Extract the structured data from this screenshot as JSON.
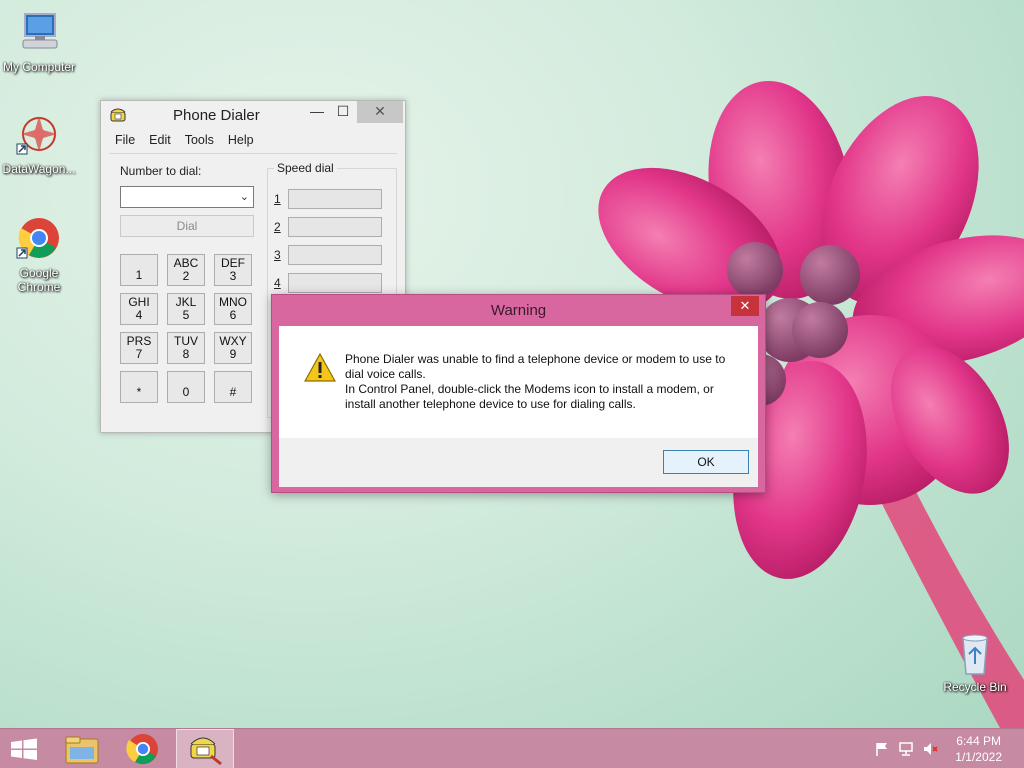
{
  "desktop": {
    "icons": [
      {
        "label": "My Computer",
        "icon": "computer-icon"
      },
      {
        "label": "DataWagon...",
        "icon": "datawagon-icon"
      },
      {
        "label": "Google Chrome",
        "icon": "chrome-icon"
      },
      {
        "label": "Recycle Bin",
        "icon": "recycle-bin-icon"
      }
    ]
  },
  "dialer": {
    "title": "Phone Dialer",
    "window_buttons": {
      "minimize": "—",
      "maximize": "☐",
      "close": "✕"
    },
    "menu": [
      "File",
      "Edit",
      "Tools",
      "Help"
    ],
    "number_label": "Number to dial:",
    "number_value": "",
    "dial_label": "Dial",
    "keypad": [
      {
        "letters": "",
        "digit": "1"
      },
      {
        "letters": "ABC",
        "digit": "2"
      },
      {
        "letters": "DEF",
        "digit": "3"
      },
      {
        "letters": "GHI",
        "digit": "4"
      },
      {
        "letters": "JKL",
        "digit": "5"
      },
      {
        "letters": "MNO",
        "digit": "6"
      },
      {
        "letters": "PRS",
        "digit": "7"
      },
      {
        "letters": "TUV",
        "digit": "8"
      },
      {
        "letters": "WXY",
        "digit": "9"
      },
      {
        "letters": "",
        "digit": "*"
      },
      {
        "letters": "",
        "digit": "0"
      },
      {
        "letters": "",
        "digit": "#"
      }
    ],
    "speed_dial_label": "Speed dial",
    "speed_dial": [
      "1",
      "2",
      "3",
      "4"
    ]
  },
  "warning": {
    "title": "Warning",
    "close": "✕",
    "message_line1": "Phone Dialer was unable to find a telephone device or modem to use to dial voice calls.",
    "message_line2": "In Control Panel, double-click the Modems icon to install a modem, or install another telephone device to use for dialing calls.",
    "ok_label": "OK"
  },
  "taskbar": {
    "items": [
      "start-icon",
      "file-explorer-icon",
      "chrome-icon",
      "phone-dialer-icon"
    ],
    "tray": [
      "flag-icon",
      "network-icon",
      "volume-muted-icon"
    ],
    "time": "6:44 PM",
    "date": "1/1/2022"
  },
  "colors": {
    "taskbar": "#c78aa3",
    "dialog_frame": "#d9679f",
    "close_red": "#c7333a",
    "flower_pink": "#e8408a"
  }
}
